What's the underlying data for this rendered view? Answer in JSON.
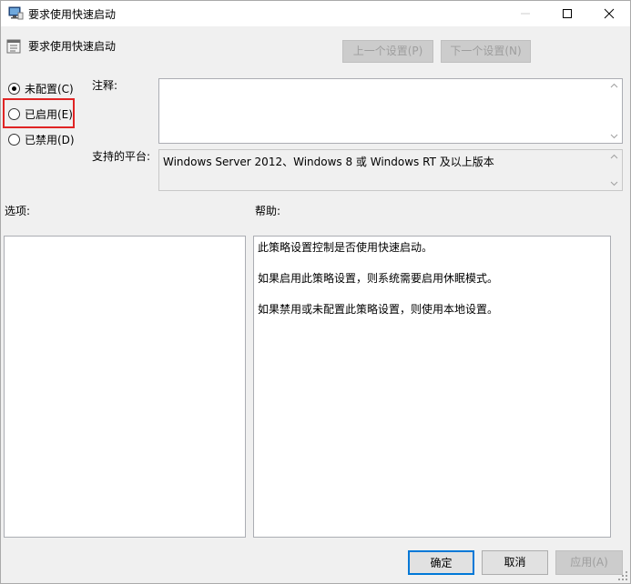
{
  "window": {
    "title": "要求使用快速启动",
    "policy_name": "要求使用快速启动"
  },
  "nav": {
    "prev_label": "上一个设置(P)",
    "next_label": "下一个设置(N)"
  },
  "radios": {
    "not_configured": "未配置(C)",
    "enabled": "已启用(E)",
    "disabled": "已禁用(D)",
    "selected": "not_configured"
  },
  "labels": {
    "comment": "注释:",
    "platform": "支持的平台:",
    "options": "选项:",
    "help": "帮助:"
  },
  "platform_text": "Windows Server 2012、Windows 8 或 Windows RT 及以上版本",
  "comment_value": "",
  "help": {
    "line1": "此策略设置控制是否使用快速启动。",
    "line2": "如果启用此策略设置，则系统需要启用休眠模式。",
    "line3": "如果禁用或未配置此策略设置，则使用本地设置。"
  },
  "buttons": {
    "ok": "确定",
    "cancel": "取消",
    "apply": "应用(A)"
  },
  "colors": {
    "highlight": "#e02424",
    "focus_border": "#0078d7"
  }
}
